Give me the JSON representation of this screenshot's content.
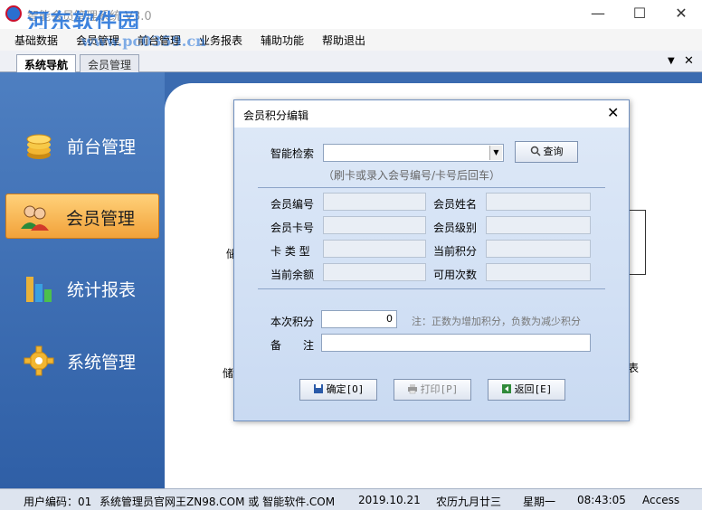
{
  "window": {
    "title": "智能会员管理系统 V3.0",
    "watermark_top": "河东软件园",
    "watermark_url": "www.pc0359.cn",
    "minimize_glyph": "—",
    "maximize_glyph": "☐",
    "close_glyph": "✕"
  },
  "menu": [
    "基础数据",
    "会员管理",
    "前台管理",
    "业务报表",
    "辅助功能",
    "帮助退出"
  ],
  "tabs": {
    "nav": "系统导航",
    "member": "会员管理",
    "dropdown_glyph": "▼",
    "close_glyph": "✕"
  },
  "sidebar": {
    "items": [
      {
        "label": "前台管理",
        "icon": "coins-icon"
      },
      {
        "label": "会员管理",
        "icon": "users-icon",
        "active": true
      },
      {
        "label": "统计报表",
        "icon": "bar-chart-icon"
      },
      {
        "label": "系统管理",
        "icon": "gear-icon"
      }
    ]
  },
  "background": {
    "text1": "储",
    "text2": "储",
    "text3": "表"
  },
  "dialog": {
    "title": "会员积分编辑",
    "close_glyph": "✕",
    "search_label": "智能检索",
    "search_value": "",
    "search_hint": "（刷卡或录入会号编号/卡号后回车）",
    "search_button": "查询",
    "fields": {
      "member_no": "会员编号",
      "member_name": "会员姓名",
      "card_no": "会员卡号",
      "member_level": "会员级别",
      "card_type": "卡 类 型",
      "current_points": "当前积分",
      "current_balance": "当前余额",
      "available_times": "可用次数"
    },
    "points_label": "本次积分",
    "points_value": "0",
    "points_note": "注：正数为增加积分，负数为减少积分",
    "remark_label": "备　　注",
    "remark_value": "",
    "buttons": {
      "confirm": "确定[O]",
      "print": "打印[P]",
      "back": "返回[E]"
    }
  },
  "status": {
    "user": "用户编码：01",
    "company": "系统管理员官网王ZN98.COM 或 智能软件.COM",
    "date": "2019.10.21",
    "lunar": "农历九月廿三",
    "weekday": "星期一",
    "time": "08:43:05",
    "db": "Access"
  },
  "colors": {
    "sidebar": "#3b6bb0",
    "active_item": "#f2a23a",
    "dialog_bg": "#d6e3f5"
  }
}
